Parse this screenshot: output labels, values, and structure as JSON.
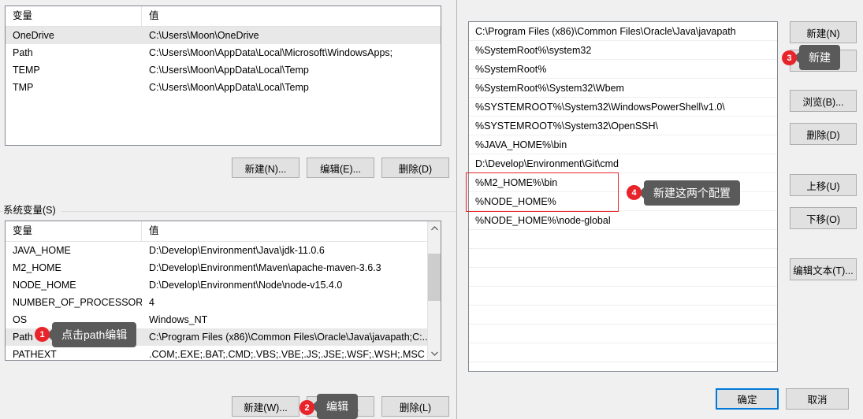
{
  "left_dialog": {
    "user_vars": {
      "headers": {
        "variable": "变量",
        "value": "值"
      },
      "rows": [
        {
          "variable": "OneDrive",
          "value": "C:\\Users\\Moon\\OneDrive",
          "selected": true
        },
        {
          "variable": "Path",
          "value": "C:\\Users\\Moon\\AppData\\Local\\Microsoft\\WindowsApps;",
          "selected": false
        },
        {
          "variable": "TEMP",
          "value": "C:\\Users\\Moon\\AppData\\Local\\Temp",
          "selected": false
        },
        {
          "variable": "TMP",
          "value": "C:\\Users\\Moon\\AppData\\Local\\Temp",
          "selected": false
        }
      ],
      "buttons": {
        "new": "新建(N)...",
        "edit": "编辑(E)...",
        "delete": "删除(D)"
      }
    },
    "system_vars": {
      "group_label": "系统变量(S)",
      "headers": {
        "variable": "变量",
        "value": "值"
      },
      "rows": [
        {
          "variable": "JAVA_HOME",
          "value": "D:\\Develop\\Environment\\Java\\jdk-11.0.6",
          "selected": false
        },
        {
          "variable": "M2_HOME",
          "value": "D:\\Develop\\Environment\\Maven\\apache-maven-3.6.3",
          "selected": false
        },
        {
          "variable": "NODE_HOME",
          "value": "D:\\Develop\\Environment\\Node\\node-v15.4.0",
          "selected": false
        },
        {
          "variable": "NUMBER_OF_PROCESSORS",
          "value": "4",
          "selected": false
        },
        {
          "variable": "OS",
          "value": "Windows_NT",
          "selected": false
        },
        {
          "variable": "Path",
          "value": "C:\\Program Files (x86)\\Common Files\\Oracle\\Java\\javapath;C:...",
          "selected": true
        },
        {
          "variable": "PATHEXT",
          "value": ".COM;.EXE;.BAT;.CMD;.VBS;.VBE;.JS;.JSE;.WSF;.WSH;.MSC",
          "selected": false
        }
      ],
      "buttons": {
        "new": "新建(W)...",
        "edit": "编辑(I)...",
        "delete": "删除(L)"
      },
      "scrollbar": {
        "up": "⌃",
        "down": "⌄"
      }
    }
  },
  "right_dialog": {
    "path_entries": [
      "C:\\Program Files (x86)\\Common Files\\Oracle\\Java\\javapath",
      "%SystemRoot%\\system32",
      "%SystemRoot%",
      "%SystemRoot%\\System32\\Wbem",
      "%SYSTEMROOT%\\System32\\WindowsPowerShell\\v1.0\\",
      "%SYSTEMROOT%\\System32\\OpenSSH\\",
      "%JAVA_HOME%\\bin",
      "D:\\Develop\\Environment\\Git\\cmd",
      "%M2_HOME%\\bin",
      "%NODE_HOME%",
      "%NODE_HOME%\\node-global",
      "",
      "",
      "",
      "",
      "",
      "",
      "",
      ""
    ],
    "highlight_color": "#e8242b",
    "buttons": {
      "new": "新建(N)",
      "edit": "编辑(E)",
      "browse": "浏览(B)...",
      "delete": "删除(D)",
      "move_up": "上移(U)",
      "move_down": "下移(O)",
      "edit_text": "编辑文本(T)...",
      "ok": "确定",
      "cancel": "取消"
    },
    "accent_color": "#0078d7"
  },
  "annotations": [
    {
      "number": "1",
      "text": "点击path编辑"
    },
    {
      "number": "2",
      "text": "编辑"
    },
    {
      "number": "3",
      "text": "新建"
    },
    {
      "number": "4",
      "text": "新建这两个配置"
    }
  ]
}
